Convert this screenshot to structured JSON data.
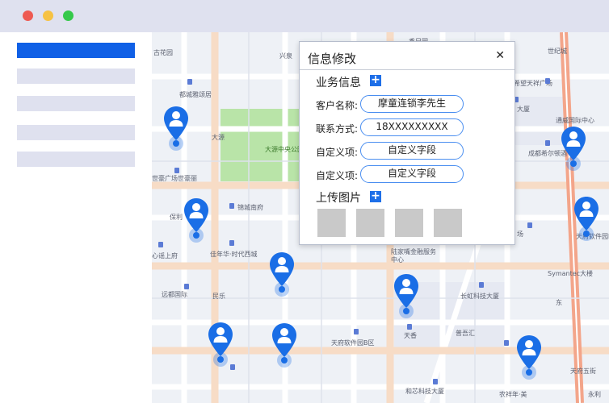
{
  "window": {
    "controls": [
      "close",
      "minimize",
      "maximize"
    ],
    "colors": {
      "close": "#ee5a52",
      "minimize": "#f6c243",
      "maximize": "#35c94a"
    }
  },
  "sidebar": {
    "items": [
      {
        "state": "active"
      },
      {
        "state": "inactive"
      },
      {
        "state": "inactive"
      },
      {
        "state": "inactive"
      },
      {
        "state": "inactive"
      }
    ]
  },
  "map": {
    "labels": {
      "l1": "古花园",
      "l2": "都城雅颂居",
      "l3": "兴泉",
      "l4": "世纪城",
      "l5": "东方希望天祥广场",
      "l6": "大源",
      "l7": "大源中央公园",
      "l8": "世豪广场世豪丽",
      "l9": "锦城南府",
      "l10": "保利",
      "l11": "佳年华·时代西城",
      "l12": "心谣上府",
      "l13": "远都国际",
      "l14": "民乐",
      "l15": "通威国际中心",
      "l16": "成都希尔顿酒",
      "l17": "天府",
      "l18": "天府软件园B区",
      "l19": "天香",
      "l20": "长虹科技大厦",
      "l21": "普吾汇",
      "l22": "和芯科技大厦",
      "l23": "天府五街",
      "l24": "大厦",
      "l25": "场",
      "l26": "Symantec大楼",
      "l27": "陆家嘴金融服务中心",
      "l28": "农祥年·美",
      "l29": "永利",
      "l30": "香日园",
      "l31": "天府软件园E",
      "l32": "东"
    }
  },
  "dialog": {
    "title": "信息修改",
    "close_icon": "close-icon",
    "section_business": "业务信息",
    "fields": [
      {
        "label": "客户名称:",
        "value": "摩童连锁李先生"
      },
      {
        "label": "联系方式:",
        "value": "18XXXXXXXXX"
      },
      {
        "label": "自定义项:",
        "value": "自定义字段"
      },
      {
        "label": "自定义项:",
        "value": "自定义字段"
      }
    ],
    "section_upload": "上传图片",
    "upload_slots": 4
  },
  "colors": {
    "accent": "#1e6fe8",
    "pin": "#1a6ee6",
    "sidebar_active": "#1060e6",
    "sidebar_item": "#dfe1ef",
    "map_bg": "#eef1f6",
    "park": "#b9e4a8"
  }
}
